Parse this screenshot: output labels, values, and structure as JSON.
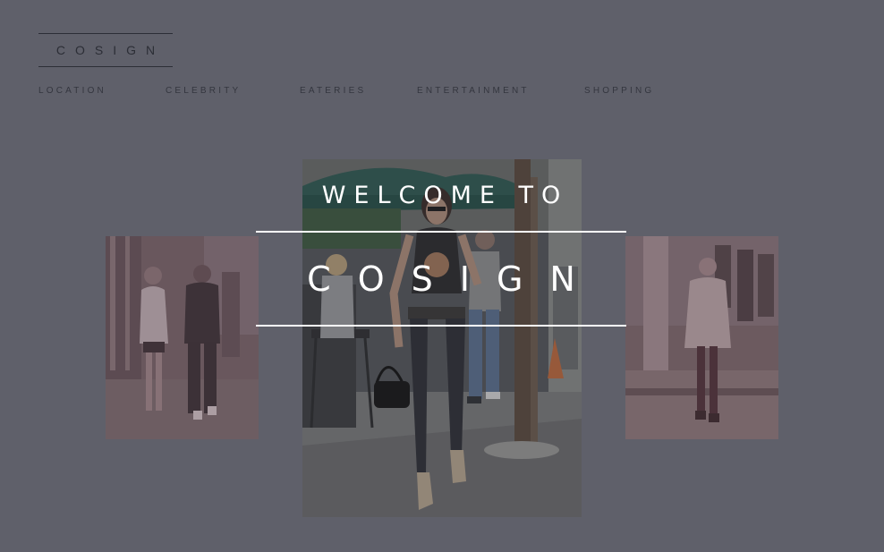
{
  "header": {
    "logo": "COSIGN"
  },
  "nav": {
    "items": [
      {
        "label": "LOCATION"
      },
      {
        "label": "CELEBRITY"
      },
      {
        "label": "EATERIES"
      },
      {
        "label": "ENTERTAINMENT"
      },
      {
        "label": "SHOPPING"
      }
    ]
  },
  "hero": {
    "welcome": "WELCOME TO",
    "brand": "COSIGN"
  },
  "colors": {
    "background": "#5f606a",
    "text_dark": "#2c2e36",
    "hero_text": "#ffffff"
  }
}
